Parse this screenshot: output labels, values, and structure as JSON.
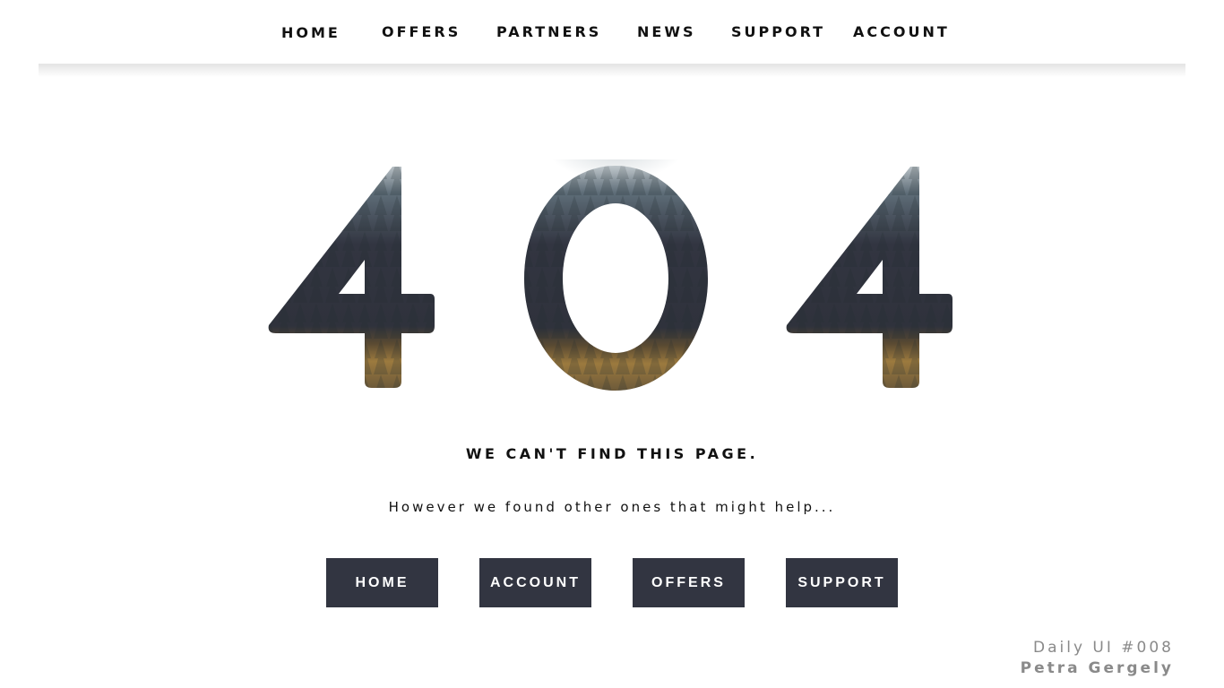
{
  "nav": {
    "items": [
      {
        "label": "HOME"
      },
      {
        "label": "OFFERS"
      },
      {
        "label": "PARTNERS"
      },
      {
        "label": "NEWS"
      },
      {
        "label": "SUPPORT"
      },
      {
        "label": "ACCOUNT"
      }
    ]
  },
  "hero": {
    "code": "404",
    "digit_color": "#323541",
    "image_theme": "foggy-forest"
  },
  "message": {
    "headline": "WE CAN'T FIND THIS PAGE.",
    "subline": "However we found other ones that might help..."
  },
  "buttons": [
    {
      "label": "HOME"
    },
    {
      "label": "ACCOUNT"
    },
    {
      "label": "OFFERS"
    },
    {
      "label": "SUPPORT"
    }
  ],
  "credit": {
    "line1": "Daily UI #008",
    "line2": "Petra Gergely"
  },
  "colors": {
    "button_bg": "#323541",
    "button_text": "#ffffff",
    "text": "#111111",
    "credit": "#8a8a8a"
  }
}
